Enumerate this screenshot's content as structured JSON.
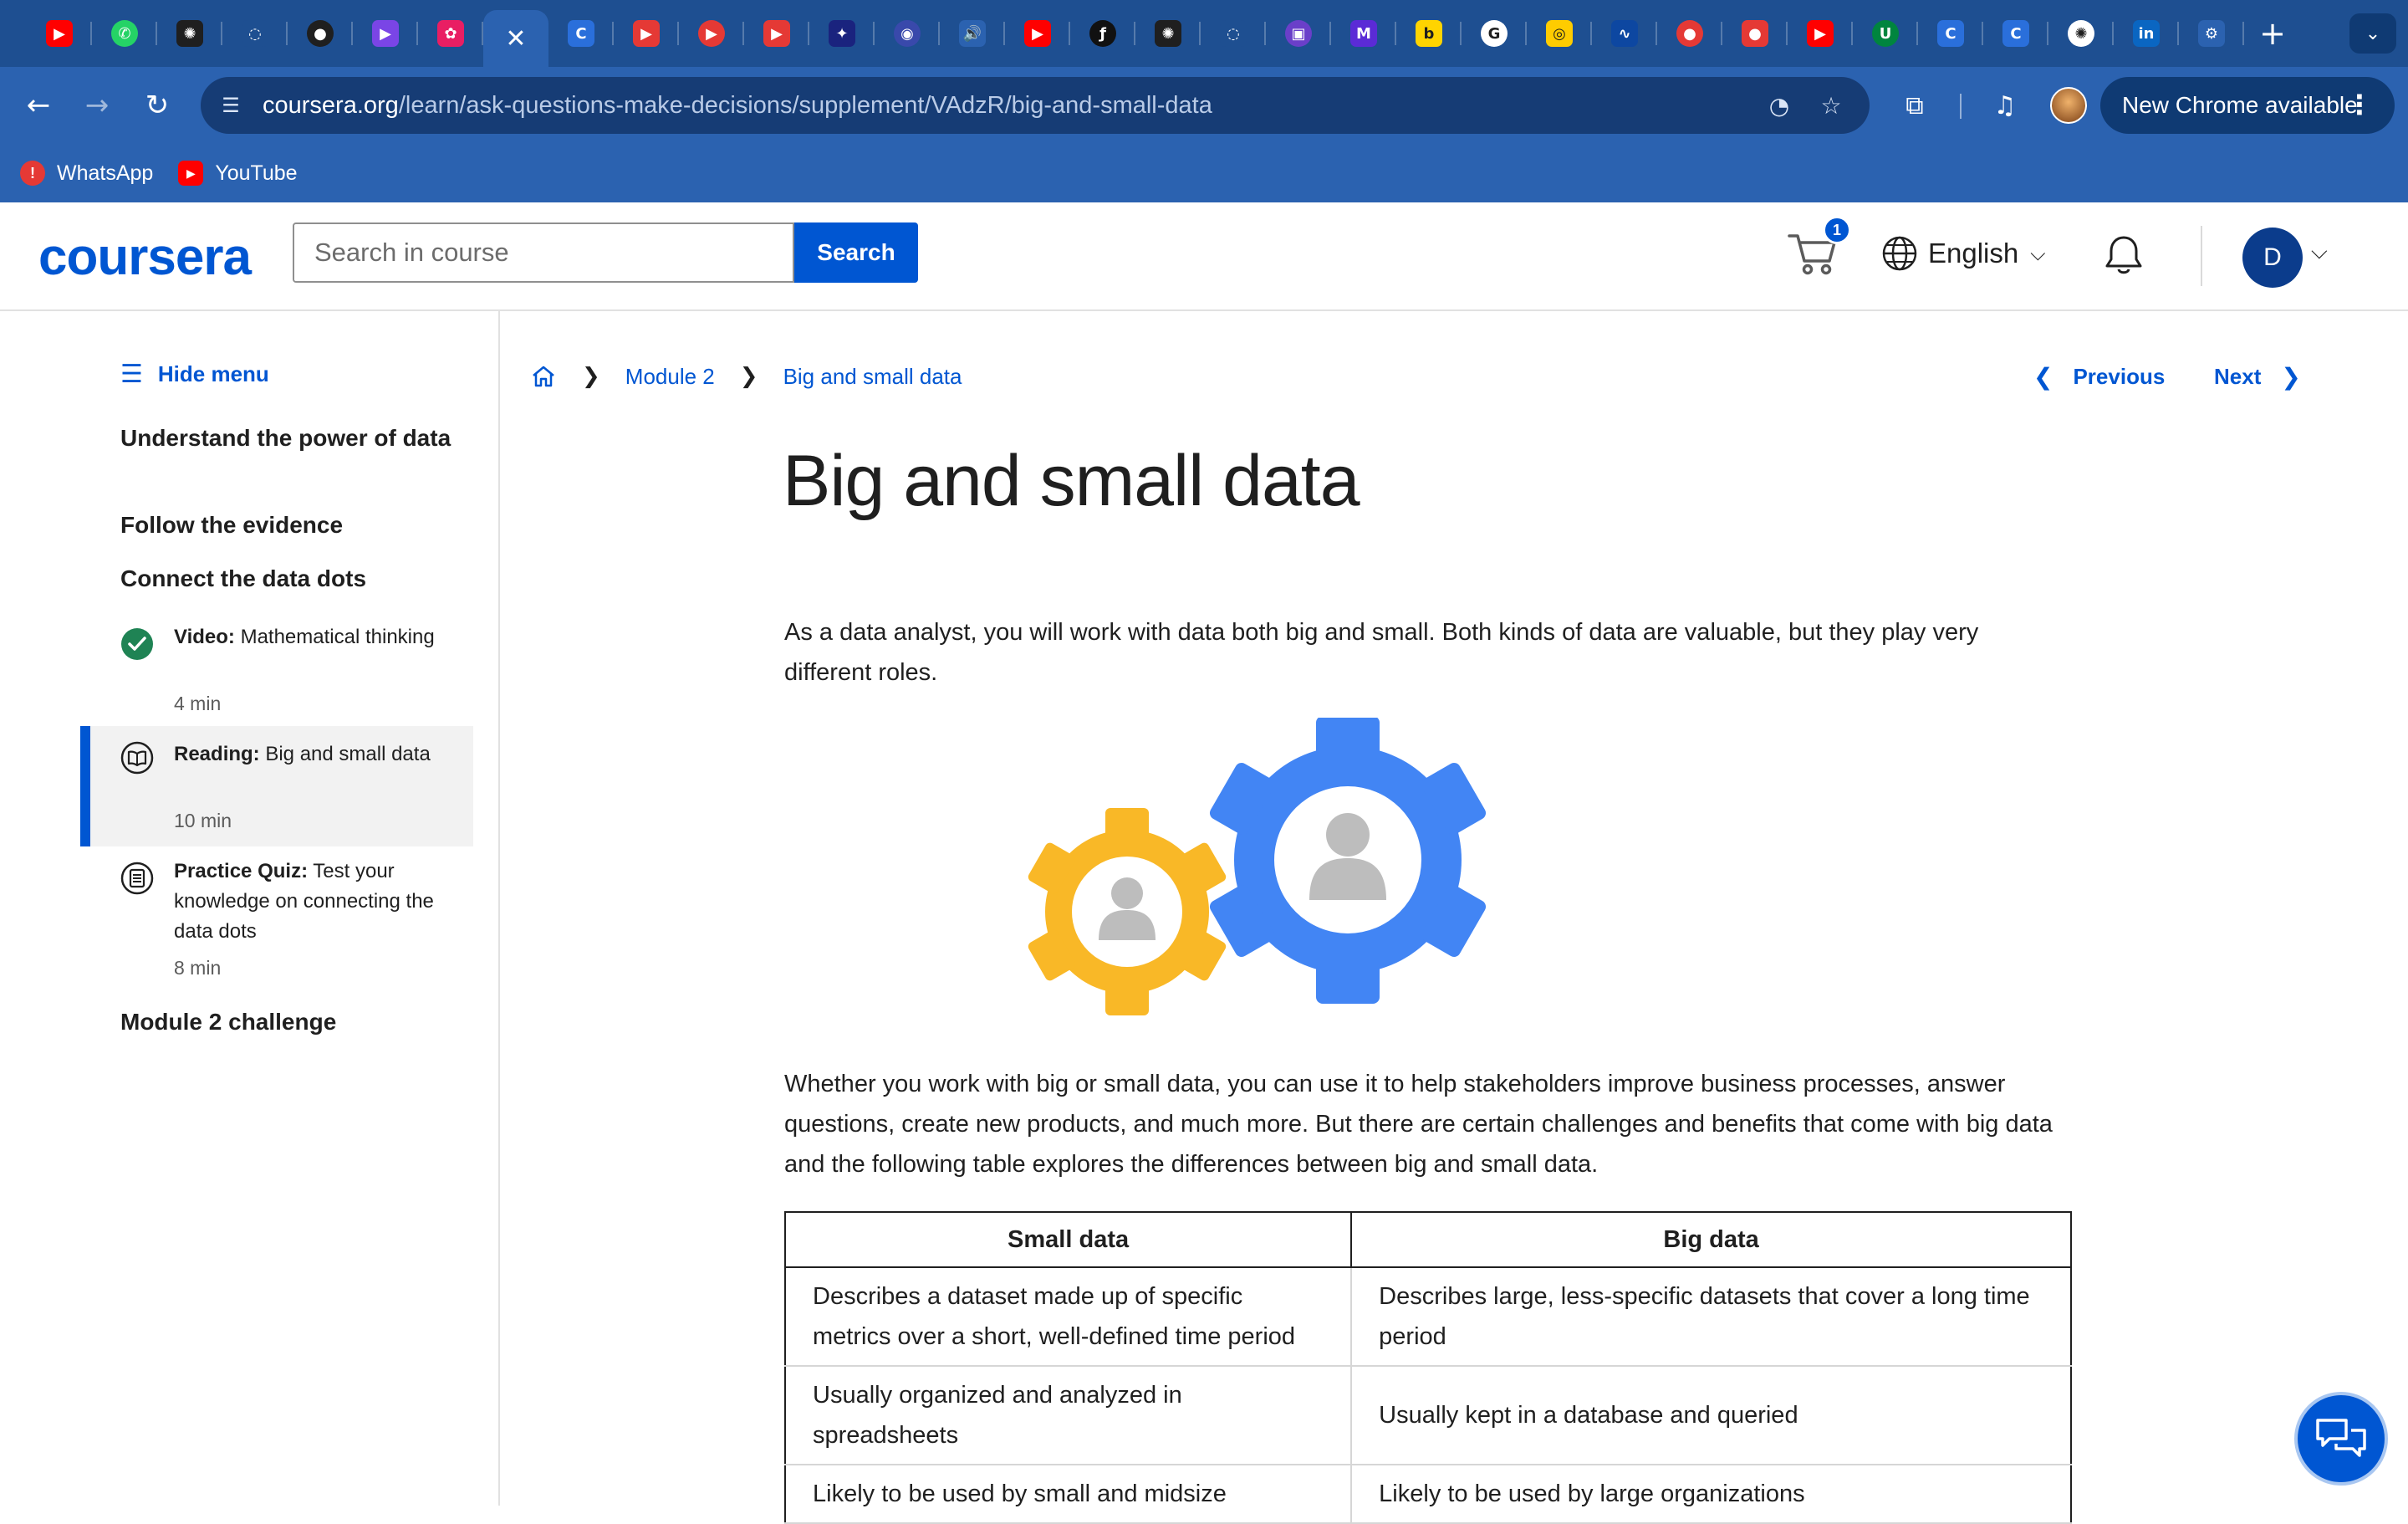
{
  "browser": {
    "tabs": [
      {
        "icon": "youtube-icon",
        "glyph": "▶",
        "color": "#ff0000"
      },
      {
        "icon": "whatsapp-icon",
        "glyph": "✆",
        "color": "#25d366"
      },
      {
        "icon": "openai-icon",
        "glyph": "✺",
        "color": "#1f1f1f"
      },
      {
        "icon": "loading-icon",
        "glyph": "◌",
        "color": "#1e4f91"
      },
      {
        "icon": "github-icon",
        "glyph": "●",
        "color": "#1f1f1f"
      },
      {
        "icon": "play-icon",
        "glyph": "▶",
        "color": "#7a45e6"
      },
      {
        "icon": "app-icon",
        "glyph": "✿",
        "color": "#e91e63"
      },
      {
        "icon": "close-icon",
        "glyph": "✕",
        "color": "#2b62b0"
      },
      {
        "icon": "coursera-icon",
        "glyph": "C",
        "color": "#2a6fdb"
      },
      {
        "icon": "youtube-icon",
        "glyph": "▶",
        "color": "#e53935"
      },
      {
        "icon": "youtube-icon",
        "glyph": "▶",
        "color": "#e53935"
      },
      {
        "icon": "youtube-icon",
        "glyph": "▶",
        "color": "#e53935"
      },
      {
        "icon": "image-icon",
        "glyph": "✦",
        "color": "#1a237e"
      },
      {
        "icon": "globe-icon",
        "glyph": "◉",
        "color": "#3949ab"
      },
      {
        "icon": "speaker-icon",
        "glyph": "🔊",
        "color": "#2b62b0"
      },
      {
        "icon": "youtube-icon",
        "glyph": "▶",
        "color": "#ff0000"
      },
      {
        "icon": "font-icon",
        "glyph": "ƒ",
        "color": "#111111"
      },
      {
        "icon": "openai-icon",
        "glyph": "✺",
        "color": "#1f1f1f"
      },
      {
        "icon": "loading-icon",
        "glyph": "◌",
        "color": "#1e4f91"
      },
      {
        "icon": "video-icon",
        "glyph": "▣",
        "color": "#6a3fc9"
      },
      {
        "icon": "metabase-icon",
        "glyph": "M",
        "color": "#5b2bd6"
      },
      {
        "icon": "b-icon",
        "glyph": "b",
        "color": "#ffd400"
      },
      {
        "icon": "google-icon",
        "glyph": "G",
        "color": "#ffffff"
      },
      {
        "icon": "target-icon",
        "glyph": "◎",
        "color": "#ffcc00"
      },
      {
        "icon": "wave-icon",
        "glyph": "∿",
        "color": "#0d47a1"
      },
      {
        "icon": "ball-icon",
        "glyph": "●",
        "color": "#e53935"
      },
      {
        "icon": "ball-icon",
        "glyph": "●",
        "color": "#e53935"
      },
      {
        "icon": "youtube-icon",
        "glyph": "▶",
        "color": "#ff0000"
      },
      {
        "icon": "unt-icon",
        "glyph": "U",
        "color": "#00853e"
      },
      {
        "icon": "coursera-icon",
        "glyph": "C",
        "color": "#2a6fdb"
      },
      {
        "icon": "coursera-icon",
        "glyph": "C",
        "color": "#2a6fdb"
      },
      {
        "icon": "chatgpt-icon",
        "glyph": "✺",
        "color": "#ffffff"
      },
      {
        "icon": "linkedin-icon",
        "glyph": "in",
        "color": "#0a66c2"
      },
      {
        "icon": "settings-icon",
        "glyph": "⚙",
        "color": "#2b62b0"
      }
    ],
    "url_host": "coursera.org",
    "url_path": "/learn/ask-questions-make-decisions/supplement/VAdzR/big-and-small-data",
    "update_label": "New Chrome available",
    "bookmarks": [
      {
        "label": "WhatsApp",
        "color": "#e53935",
        "glyph": "!"
      },
      {
        "label": "YouTube",
        "color": "#ff0000",
        "glyph": "▶"
      }
    ]
  },
  "header": {
    "logo": "coursera",
    "search_placeholder": "Search in course",
    "search_button": "Search",
    "cart_count": "1",
    "language": "English",
    "avatar_initial": "D"
  },
  "sidebar": {
    "hide_menu": "Hide menu",
    "lessons": [
      "Understand the power of data",
      "Follow the evidence",
      "Connect the data dots"
    ],
    "items": [
      {
        "type": "Video:",
        "title": "Mathematical thinking",
        "duration": "4 min",
        "status": "completed"
      },
      {
        "type": "Reading:",
        "title": "Big and small data",
        "duration": "10 min",
        "status": "active"
      },
      {
        "type": "Practice Quiz:",
        "title": "Test your knowledge on connecting the data dots",
        "duration": "8 min",
        "status": "pending"
      }
    ],
    "challenge": "Module 2 challenge"
  },
  "breadcrumb": {
    "module": "Module 2",
    "page": "Big and small data"
  },
  "pager": {
    "previous": "Previous",
    "next": "Next"
  },
  "article": {
    "title": "Big and small data",
    "intro": "As a data analyst, you will work with data both big and small. Both kinds of data are valuable, but they play very different roles.",
    "body": "Whether you work with big or small data, you can use it to help stakeholders improve business processes, answer questions, create new products, and much more. But there are certain challenges and benefits that come with big data and the following table explores the differences between big and small data.",
    "table": {
      "headers": [
        "Small data",
        "Big data"
      ],
      "rows": [
        [
          "Describes a dataset made up of specific metrics over a short, well-defined time period",
          "Describes large, less-specific datasets that cover a long time period"
        ],
        [
          "Usually organized and analyzed in spreadsheets",
          "Usually kept in a database and queried"
        ],
        [
          "Likely to be used by small and midsize",
          "Likely to be used by large organizations"
        ]
      ]
    }
  },
  "colors": {
    "accent": "#0056d2",
    "chrome": "#2b62b0",
    "gear_small": "#f9b827",
    "gear_large": "#4285f4"
  }
}
